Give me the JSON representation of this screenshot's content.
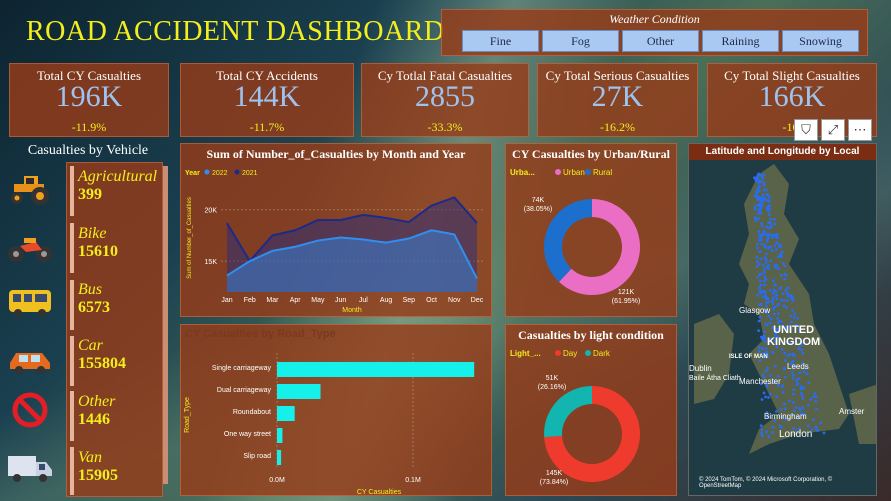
{
  "title": "ROAD ACCIDENT DASHBOARD",
  "weather": {
    "title": "Weather Condition",
    "options": [
      "Fine",
      "Fog",
      "Other",
      "Raining",
      "Snowing"
    ]
  },
  "kpis": [
    {
      "title": "Total CY Casualties",
      "value": "196K",
      "change": "-11.9%"
    },
    {
      "title": "Total CY Accidents",
      "value": "144K",
      "change": "-11.7%"
    },
    {
      "title": "Cy Totlal Fatal Casualties",
      "value": "2855",
      "change": "-33.3%"
    },
    {
      "title": "Cy Total Serious Casualties",
      "value": "27K",
      "change": "-16.2%"
    },
    {
      "title": "Cy Total Slight Casualties",
      "value": "166K",
      "change": "-10."
    }
  ],
  "vehicles": {
    "title": "Casualties by Vehicle",
    "items": [
      {
        "name": "Agricultural",
        "value": "399",
        "icon": "tractor-icon"
      },
      {
        "name": "Bike",
        "value": "15610",
        "icon": "motorbike-icon"
      },
      {
        "name": "Bus",
        "value": "6573",
        "icon": "bus-icon"
      },
      {
        "name": "Car",
        "value": "155804",
        "icon": "car-icon"
      },
      {
        "name": "Other",
        "value": "1446",
        "icon": "no-entry-icon"
      },
      {
        "name": "Van",
        "value": "15905",
        "icon": "van-icon"
      }
    ]
  },
  "chart_data": [
    {
      "type": "area",
      "title": "Sum of Number_of_Casualties by Month and Year",
      "xlabel": "Month",
      "ylabel": "Sum of Number_of_Casualties",
      "legend_title": "Year",
      "categories": [
        "Jan",
        "Feb",
        "Mar",
        "Apr",
        "May",
        "Jun",
        "Jul",
        "Aug",
        "Sep",
        "Oct",
        "Nov",
        "Dec"
      ],
      "yticks": [
        "15K",
        "20K"
      ],
      "ylim": [
        12000,
        22500
      ],
      "series": [
        {
          "name": "2022",
          "color": "#2f8ff0",
          "values": [
            13600,
            15000,
            16000,
            16400,
            17000,
            17300,
            17100,
            16800,
            17200,
            18000,
            17600,
            13300
          ]
        },
        {
          "name": "2021",
          "color": "#1c2a8a",
          "values": [
            18700,
            15000,
            17500,
            18000,
            19000,
            19000,
            19500,
            19200,
            18800,
            20400,
            21200,
            18700
          ]
        }
      ]
    },
    {
      "type": "pie",
      "title": "CY Casualties by Urban/Rural",
      "legend_title": "Urba...",
      "series": [
        {
          "name": "Urban",
          "color": "#ea6ec4",
          "value": 121,
          "label": "121K",
          "pct": "(61.95%)"
        },
        {
          "name": "Rural",
          "color": "#1c6fcc",
          "value": 74,
          "label": "74K",
          "pct": "(38.05%)"
        }
      ]
    },
    {
      "type": "bar",
      "title": "CY Casualties by Road_Type",
      "xlabel": "CY Casualties",
      "ylabel": "Road_Type",
      "categories": [
        "Single carriageway",
        "Dual carriageway",
        "Roundabout",
        "One way street",
        "Slip road"
      ],
      "values": [
        145000,
        32000,
        13000,
        4000,
        3000
      ],
      "xticks": [
        "0.0M",
        "0.1M"
      ],
      "color": "#16f0ea"
    },
    {
      "type": "pie",
      "title": "Casualties by light condition",
      "legend_title": "Light_...",
      "series": [
        {
          "name": "Day",
          "color": "#ee3b2d",
          "value": 145,
          "label": "145K",
          "pct": "(73.84%)"
        },
        {
          "name": "Dark",
          "color": "#12b5b0",
          "value": 51,
          "label": "51K",
          "pct": "(26.16%)"
        }
      ]
    }
  ],
  "map": {
    "title": "Latitude and Longitude by Local",
    "labels": [
      "UNITED",
      "KINGDOM",
      "Glasgow",
      "ISLE OF MAN",
      "Leeds",
      "Manchester",
      "Birmingham",
      "London",
      "Dublin",
      "Baile Átha Cliath",
      "Amster"
    ],
    "copyright": "© 2024 TomTom, © 2024 Microsoft Corporation, © OpenStreetMap"
  },
  "toolbar": {
    "filter": "⛉",
    "focus": "⤢",
    "more": "⋯"
  }
}
